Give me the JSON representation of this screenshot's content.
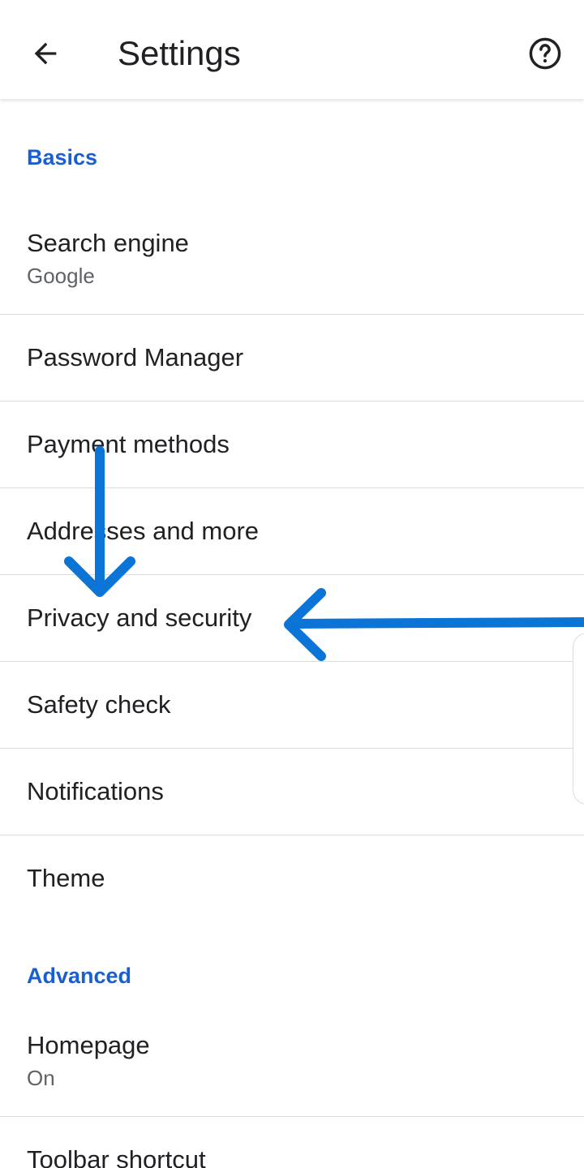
{
  "toolbar": {
    "title": "Settings",
    "back_icon": "arrow-left-icon",
    "help_icon": "help-circle-icon"
  },
  "sections": {
    "basics": "Basics",
    "advanced": "Advanced"
  },
  "items": {
    "search_engine": {
      "label": "Search engine",
      "value": "Google"
    },
    "password_manager": {
      "label": "Password Manager"
    },
    "payment_methods": {
      "label": "Payment methods"
    },
    "addresses": {
      "label": "Addresses and more"
    },
    "privacy": {
      "label": "Privacy and security"
    },
    "safety_check": {
      "label": "Safety check"
    },
    "notifications": {
      "label": "Notifications"
    },
    "theme": {
      "label": "Theme"
    },
    "homepage": {
      "label": "Homepage",
      "value": "On"
    },
    "toolbar_shortcut": {
      "label": "Toolbar shortcut"
    }
  },
  "colors": {
    "accent": "#1a5fd0",
    "annotation_arrow": "#0b74d6",
    "divider": "#dadce0"
  }
}
